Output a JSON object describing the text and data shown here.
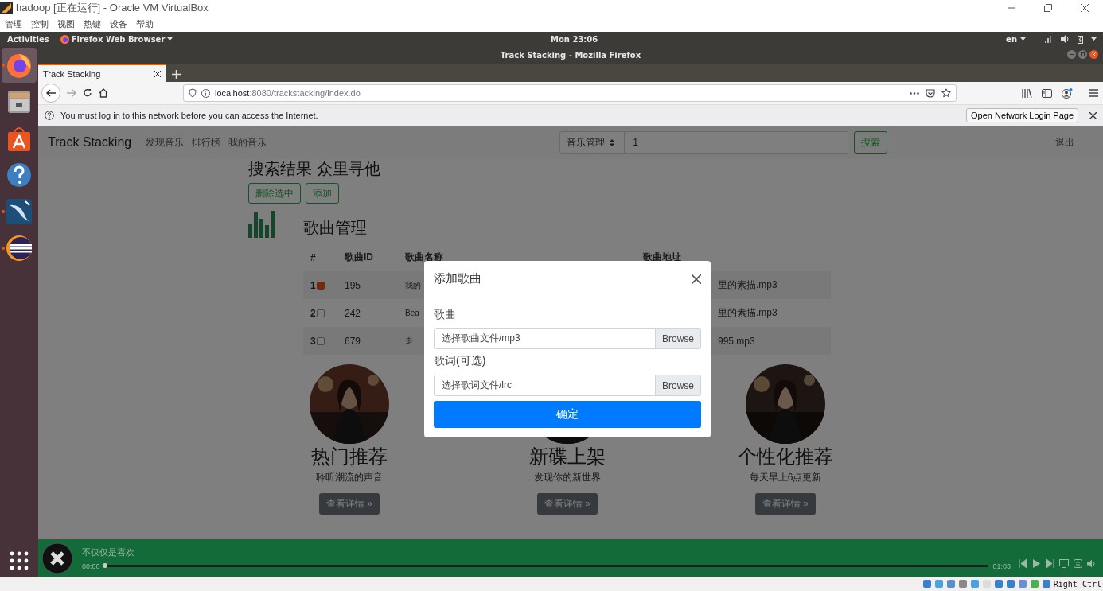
{
  "vbox": {
    "title": "hadoop [正在运行] - Oracle VM VirtualBox",
    "menu": [
      "管理",
      "控制",
      "视图",
      "热键",
      "设备",
      "帮助"
    ],
    "host_key": "Right Ctrl"
  },
  "topbar": {
    "activities": "Activities",
    "app_menu": "Firefox Web Browser",
    "clock": "Mon 23:06",
    "language": "en"
  },
  "dock": [
    {
      "kind": "firefox",
      "running": true
    },
    {
      "kind": "files",
      "running": false
    },
    {
      "kind": "store",
      "running": false
    },
    {
      "kind": "help",
      "running": false
    },
    {
      "kind": "mysql",
      "running": true
    },
    {
      "kind": "eclipse",
      "running": true
    }
  ],
  "firefox": {
    "window_title": "Track Stacking - Mozilla Firefox",
    "tabs": [
      {
        "label": "Track Stacking",
        "selected": true
      }
    ],
    "url_host": "localhost",
    "url_path": ":8080/trackstacking/index.do",
    "notification": "You must log in to this network before you can access the Internet.",
    "notification_button": "Open Network Login Page"
  },
  "navbar": {
    "brand": "Track Stacking",
    "links": [
      "发现音乐",
      "排行榜",
      "我的音乐"
    ],
    "category": "音乐管理",
    "query": "1",
    "search_button": "搜索",
    "logout": "退出"
  },
  "heading": "搜索结果 众里寻他",
  "actions": [
    "删除选中",
    "添加"
  ],
  "section_title": "歌曲管理",
  "table": {
    "columns": [
      "#",
      "歌曲ID",
      "歌曲名称",
      "歌曲地址"
    ],
    "rows": [
      {
        "index": "1",
        "checked": true,
        "id": "195",
        "name": "我的",
        "address": "里的素描.mp3"
      },
      {
        "index": "2",
        "checked": false,
        "id": "242",
        "name": "Bea",
        "address": "里的素描.mp3"
      },
      {
        "index": "3",
        "checked": false,
        "id": "679",
        "name": "走",
        "address": "995.mp3"
      }
    ]
  },
  "cards": [
    {
      "title": "热门推荐",
      "text": "聆听潮流的声音",
      "button": "查看详情 »"
    },
    {
      "title": "新碟上架",
      "text": "发现你的新世界",
      "button": "查看详情 »"
    },
    {
      "title": "个性化推荐",
      "text": "每天早上6点更新",
      "button": "查看详情 »"
    }
  ],
  "player": {
    "title": "不仅仅是喜欢",
    "elapsed": "00:00",
    "duration": "01:03",
    "level": 0
  },
  "modal": {
    "title": "添加歌曲",
    "fields": [
      {
        "label": "歌曲",
        "placeholder": "选择歌曲文件/mp3",
        "button": "Browse"
      },
      {
        "label": "歌词(可选)",
        "placeholder": "选择歌词文件/lrc",
        "button": "Browse"
      }
    ],
    "submit": "确定"
  }
}
